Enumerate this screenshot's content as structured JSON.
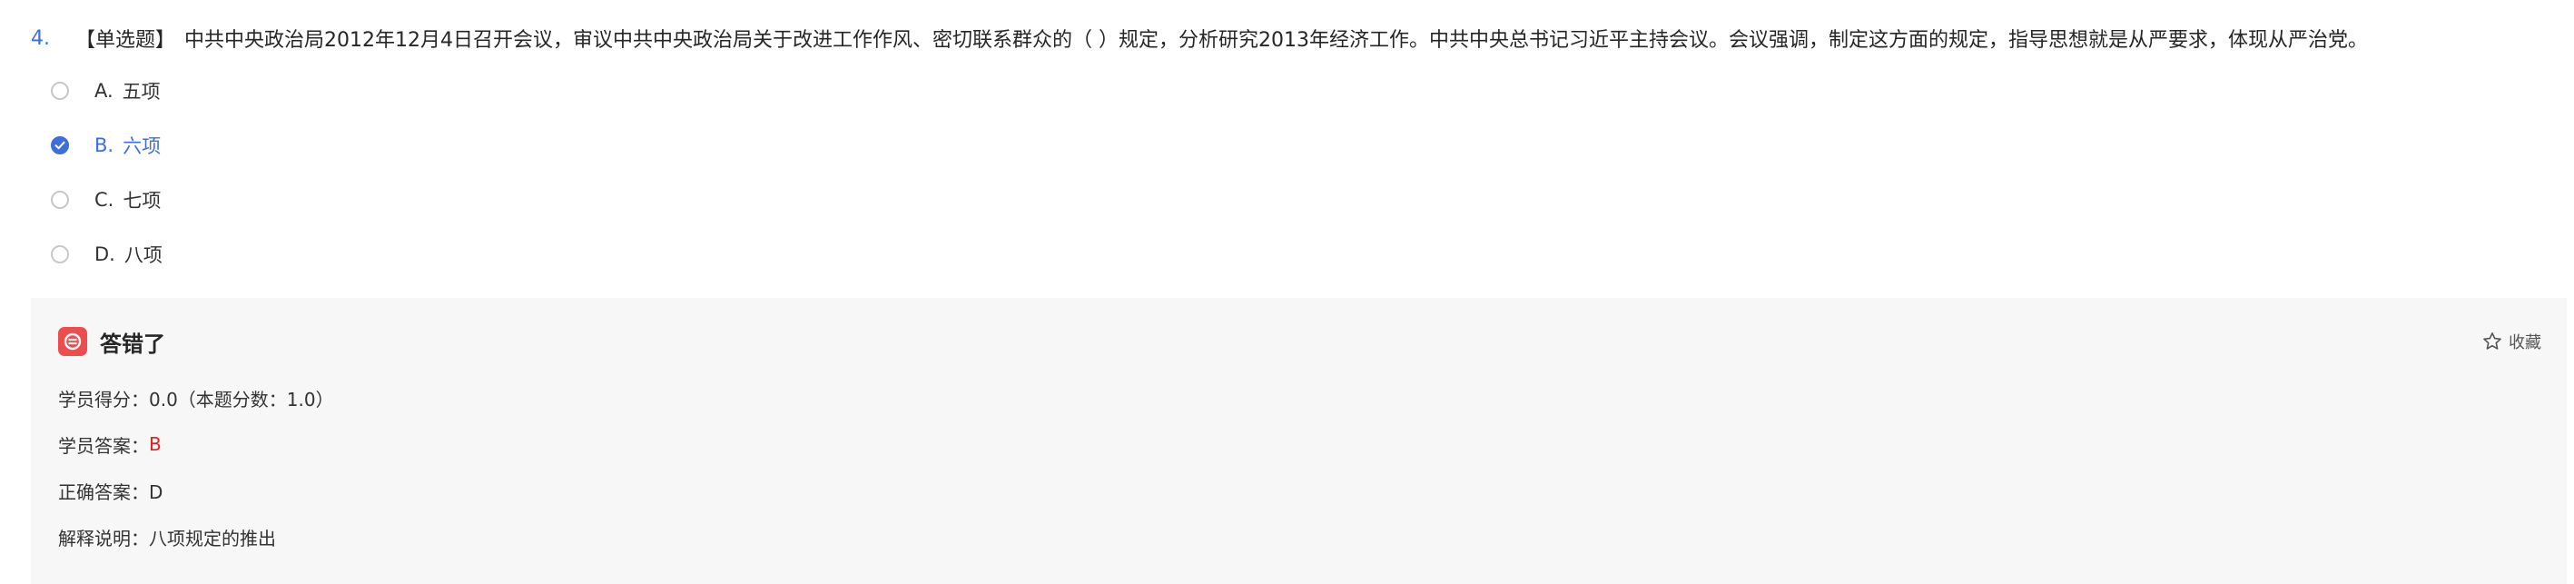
{
  "question": {
    "number": "4.",
    "type_label": "【单选题】",
    "stem": "中共中央政治局2012年12月4日召开会议，审议中共中央政治局关于改进工作作风、密切联系群众的（ ）规定，分析研究2013年经济工作。中共中央总书记习近平主持会议。会议强调，制定这方面的规定，指导思想就是从严要求，体现从严治党。"
  },
  "options": [
    {
      "letter": "A.",
      "text": "五项",
      "selected": false
    },
    {
      "letter": "B.",
      "text": "六项",
      "selected": true
    },
    {
      "letter": "C.",
      "text": "七项",
      "selected": false
    },
    {
      "letter": "D.",
      "text": "八项",
      "selected": false
    }
  ],
  "result": {
    "status_title": "答错了",
    "collect_label": "收藏",
    "score_line": "学员得分：0.0（本题分数：1.0）",
    "student_answer_label": "学员答案：",
    "student_answer_value": "B",
    "correct_answer_line": "正确答案：D",
    "explanation_line": "解释说明：八项规定的推出"
  },
  "colors": {
    "accent": "#3e6fd8",
    "wrong": "#ee4d4d",
    "student_answer": "#e02020",
    "panel_bg": "#f7f7f7"
  },
  "icons": {
    "status": "wrong-answer-icon",
    "collect": "star-outline-icon",
    "selected": "check-icon"
  }
}
